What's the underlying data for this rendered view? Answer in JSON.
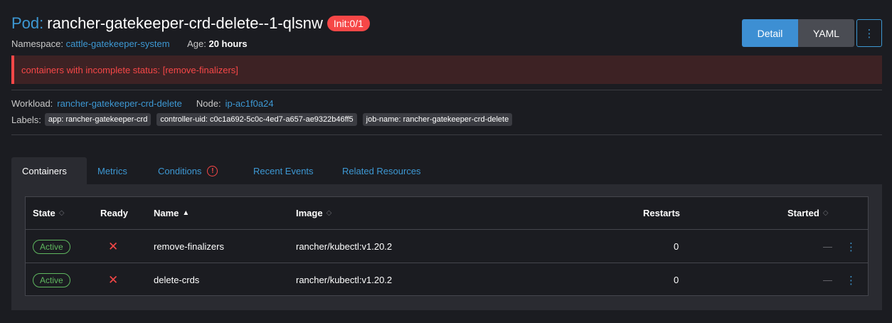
{
  "header": {
    "prefix": "Pod:",
    "name": "rancher-gatekeeper-crd-delete--1-qlsnw",
    "status_badge": "Init:0/1"
  },
  "meta": {
    "namespace_label": "Namespace:",
    "namespace_value": "cattle-gatekeeper-system",
    "age_label": "Age:",
    "age_value": "20 hours"
  },
  "actions": {
    "detail_label": "Detail",
    "yaml_label": "YAML",
    "more_icon": "⋮"
  },
  "banner": {
    "message": "containers with incomplete status: [remove-finalizers]"
  },
  "info": {
    "workload_label": "Workload:",
    "workload_value": "rancher-gatekeeper-crd-delete",
    "node_label": "Node:",
    "node_value": "ip-ac1f0a24",
    "labels_label": "Labels:",
    "labels": [
      "app: rancher-gatekeeper-crd",
      "controller-uid: c0c1a692-5c0c-4ed7-a657-ae9322b46ff5",
      "job-name: rancher-gatekeeper-crd-delete"
    ]
  },
  "tabs": [
    {
      "label": "Containers"
    },
    {
      "label": "Metrics"
    },
    {
      "label": "Conditions"
    },
    {
      "label": "Recent Events"
    },
    {
      "label": "Related Resources"
    }
  ],
  "table": {
    "columns": {
      "state": "State",
      "ready": "Ready",
      "name": "Name",
      "image": "Image",
      "restarts": "Restarts",
      "started": "Started"
    },
    "rows": [
      {
        "state": "Active",
        "ready": "✕",
        "name": "remove-finalizers",
        "image": "rancher/kubectl:v1.20.2",
        "restarts": "0",
        "started": "—"
      },
      {
        "state": "Active",
        "ready": "✕",
        "name": "delete-crds",
        "image": "rancher/kubectl:v1.20.2",
        "restarts": "0",
        "started": "—"
      }
    ]
  },
  "colors": {
    "accent": "#3d98d3",
    "error": "#f64747",
    "success": "#5fb75f",
    "background": "#1b1c21"
  }
}
